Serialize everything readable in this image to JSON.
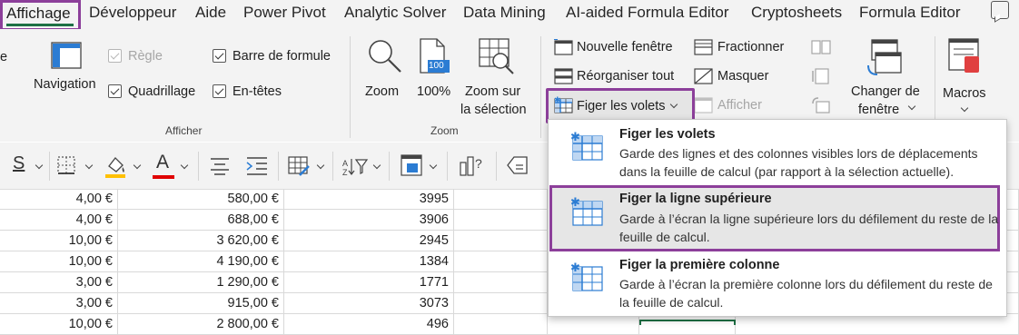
{
  "tabs": [
    {
      "label": "Affichage",
      "active": true
    },
    {
      "label": "Développeur"
    },
    {
      "label": "Aide"
    },
    {
      "label": "Power Pivot"
    },
    {
      "label": "Analytic Solver"
    },
    {
      "label": "Data Mining"
    },
    {
      "label": "AI-aided Formula Editor"
    },
    {
      "label": "Cryptosheets"
    },
    {
      "label": "Formula Editor"
    }
  ],
  "ribbon": {
    "partial_left": "e",
    "show_group": {
      "navigation_label": "Navigation",
      "ruler_label": "Règle",
      "gridlines_label": "Quadrillage",
      "formula_bar_label": "Barre de formule",
      "headings_label": "En-têtes",
      "group_label": "Afficher"
    },
    "zoom_group": {
      "zoom_label": "Zoom",
      "zoom100_label": "100%",
      "zoom100_icon_text": "100",
      "zoom_selection_line1": "Zoom sur",
      "zoom_selection_line2": "la sélection",
      "group_label": "Zoom"
    },
    "window_group": {
      "new_window_label": "Nouvelle fenêtre",
      "arrange_all_label": "Réorganiser tout",
      "freeze_panes_label": "Figer les volets",
      "split_label": "Fractionner",
      "hide_label": "Masquer",
      "unhide_label": "Afficher",
      "switch_windows_line1": "Changer de",
      "switch_windows_line2": "fenêtre"
    },
    "macros_group": {
      "macros_label": "Macros"
    }
  },
  "freeze_menu": {
    "items": [
      {
        "title": "Figer les volets",
        "description": "Garde des lignes et des colonnes visibles lors de déplacements dans la feuille de calcul (par rapport à la sélection actuelle)."
      },
      {
        "title": "Figer la ligne supérieure",
        "description": "Garde à l’écran la ligne supérieure lors du défilement du reste de la feuille de calcul.",
        "highlighted": true
      },
      {
        "title": "Figer la première colonne",
        "description": "Garde à l’écran la première colonne lors du défilement du reste de la feuille de calcul."
      }
    ]
  },
  "grid": {
    "rows": [
      [
        "4,00 €",
        "580,00 €",
        "3995"
      ],
      [
        "4,00 €",
        "688,00 €",
        "3906"
      ],
      [
        "10,00 €",
        "3 620,00 €",
        "2945"
      ],
      [
        "10,00 €",
        "4 190,00 €",
        "1384"
      ],
      [
        "3,00 €",
        "1 290,00 €",
        "1771"
      ],
      [
        "3,00 €",
        "915,00 €",
        "3073"
      ],
      [
        "10,00 €",
        "2 800,00 €",
        "496"
      ]
    ]
  },
  "colors": {
    "highlight_border": "#8c3f9a",
    "excel_green": "#1e7145",
    "ribbon_bg": "#f3f3f3",
    "icon_blue": "#2b7cd3"
  }
}
